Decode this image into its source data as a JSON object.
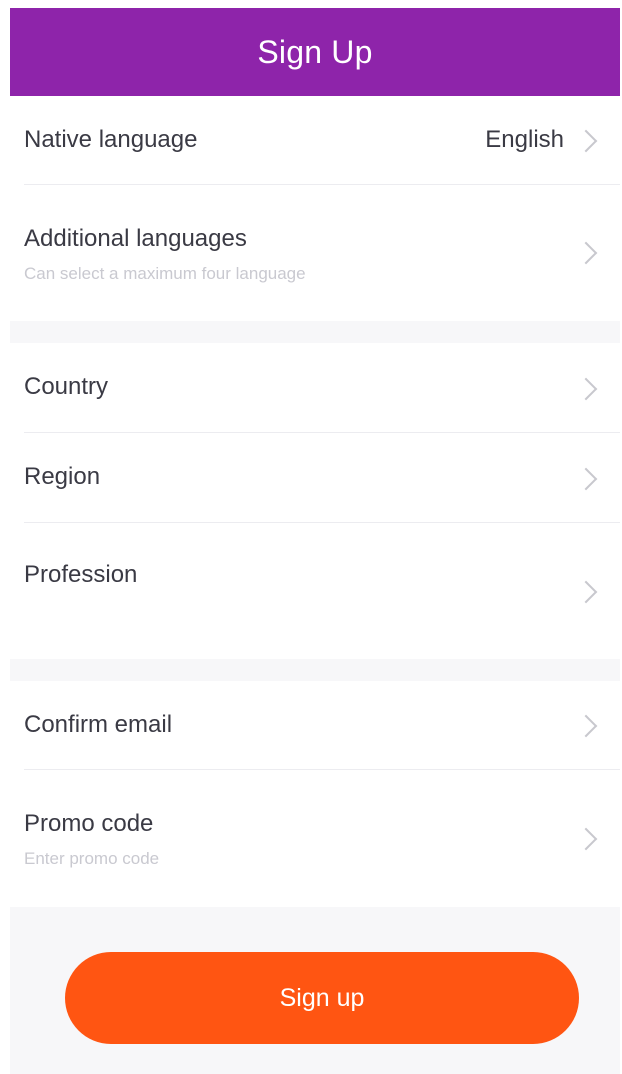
{
  "header": {
    "title": "Sign Up"
  },
  "form": {
    "native_language": {
      "label": "Native language",
      "value": "English"
    },
    "additional_languages": {
      "label": "Additional languages",
      "hint": "Can select a maximum four language"
    },
    "country": {
      "label": "Country"
    },
    "region": {
      "label": "Region"
    },
    "profession": {
      "label": "Profession"
    },
    "confirm_email": {
      "label": "Confirm email"
    },
    "promo_code": {
      "label": "Promo code",
      "placeholder": "Enter promo code"
    }
  },
  "footer": {
    "signup_label": "Sign up"
  },
  "colors": {
    "header_bg": "#8e24aa",
    "button_bg": "#ff5512"
  },
  "icons": {
    "row_chevron": "chevron-right-icon"
  }
}
